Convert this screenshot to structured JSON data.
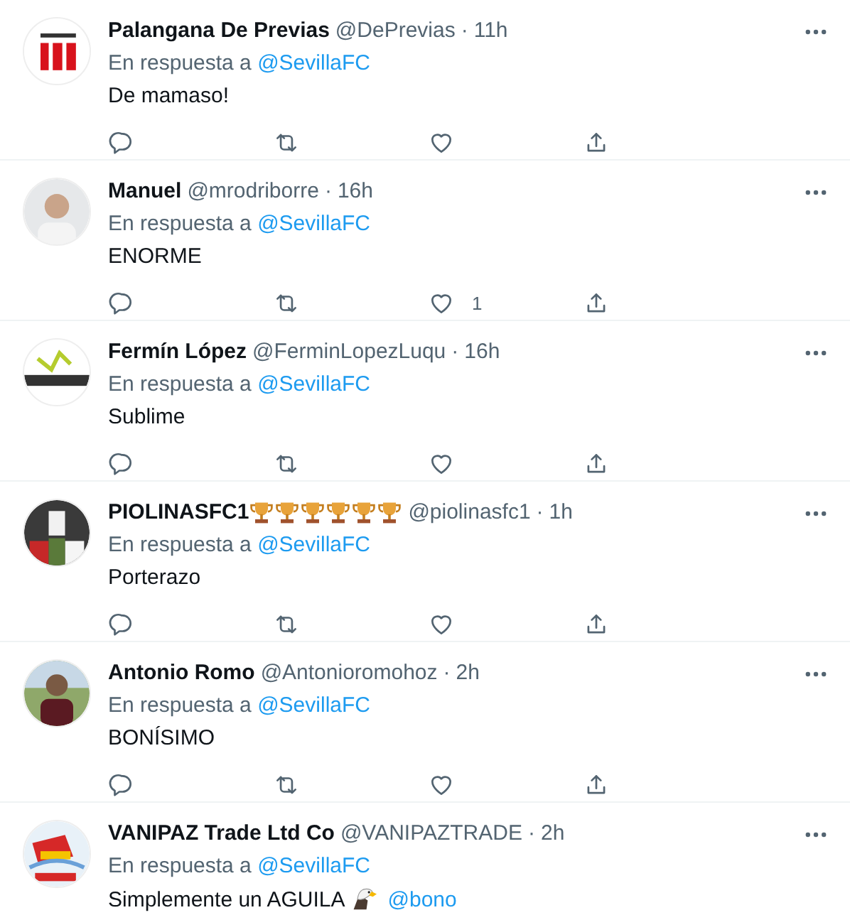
{
  "tweets": [
    {
      "name": "Palangana De Previas",
      "handle": "@DePrevias",
      "separator": "·",
      "time": "11h",
      "reply_prefix": "En respuesta a",
      "reply_to": "@SevillaFC",
      "body": [
        {
          "kind": "text",
          "text": "De mamaso!"
        }
      ],
      "actions_shown": true
    },
    {
      "name": "Manuel",
      "handle": "@mrodriborre",
      "separator": "·",
      "time": "16h",
      "reply_prefix": "En respuesta a",
      "reply_to": "@SevillaFC",
      "body": [
        {
          "kind": "text",
          "text": "ENORME"
        }
      ],
      "like_count": "1",
      "actions_shown": true
    },
    {
      "name": "Fermín López",
      "handle": "@FerminLopezLuqu",
      "separator": "·",
      "time": "16h",
      "reply_prefix": "En respuesta a",
      "reply_to": "@SevillaFC",
      "body": [
        {
          "kind": "text",
          "text": "Sublime"
        }
      ],
      "actions_shown": true
    },
    {
      "name": "PIOLINASFC1",
      "name_icons": [
        {
          "kind": "trophy"
        },
        {
          "kind": "trophy"
        },
        {
          "kind": "trophy"
        },
        {
          "kind": "trophy"
        },
        {
          "kind": "trophy"
        },
        {
          "kind": "trophy"
        }
      ],
      "handle": "@piolinasfc1",
      "separator": "·",
      "time": "1h",
      "reply_prefix": "En respuesta a",
      "reply_to": "@SevillaFC",
      "body": [
        {
          "kind": "text",
          "text": "Porterazo"
        }
      ],
      "actions_shown": true
    },
    {
      "name": "Antonio Romo",
      "handle": "@Antonioromohoz",
      "separator": "·",
      "time": "2h",
      "reply_prefix": "En respuesta a",
      "reply_to": "@SevillaFC",
      "body": [
        {
          "kind": "text",
          "text": "BONÍSIMO"
        }
      ],
      "actions_shown": true
    },
    {
      "name": "VANIPAZ Trade Ltd Co",
      "handle": "@VANIPAZTRADE",
      "separator": "·",
      "time": "2h",
      "reply_prefix": "En respuesta a",
      "reply_to": "@SevillaFC",
      "body": [
        {
          "kind": "text",
          "text": "Simplemente un AGUILA"
        },
        {
          "kind": "eagle"
        },
        {
          "kind": "mention",
          "text": "@bono"
        }
      ]
    }
  ]
}
